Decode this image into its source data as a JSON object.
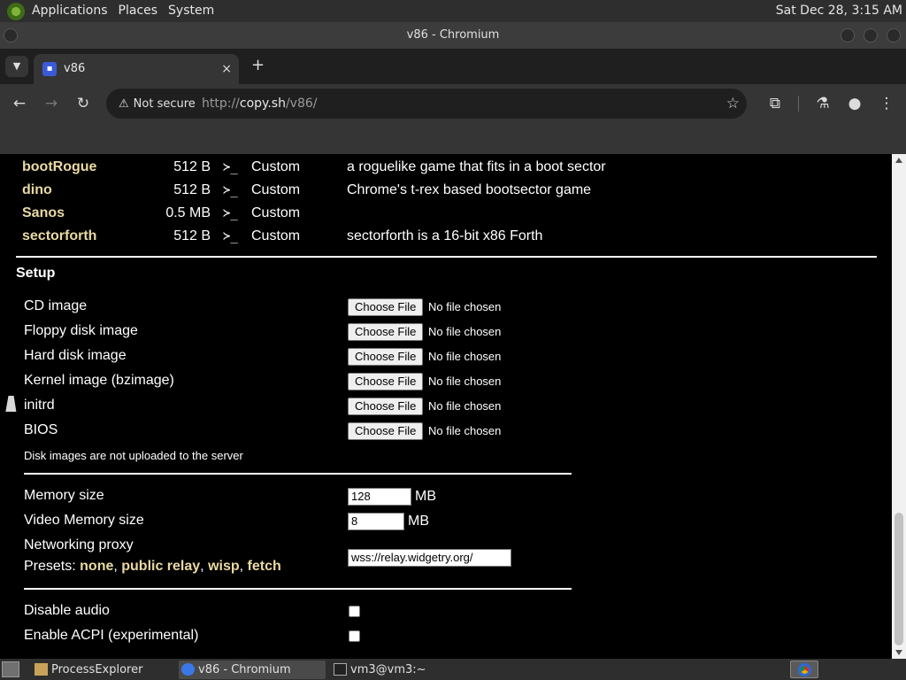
{
  "top_panel": {
    "menus": [
      "Applications",
      "Places",
      "System"
    ],
    "clock": "Sat Dec 28,  3:15 AM"
  },
  "window": {
    "title": "v86 - Chromium"
  },
  "tab": {
    "title": "v86",
    "close": "×",
    "new_tab": "+"
  },
  "toolbar": {
    "security_label": "Not secure",
    "url_scheme": "http://",
    "url_host": "copy.sh",
    "url_path": "/v86/"
  },
  "os_list": [
    {
      "name": "bootRogue",
      "size": "512 B",
      "prompt": "≻_",
      "type": "Custom",
      "description": "a roguelike game that fits in a boot sector"
    },
    {
      "name": "dino",
      "size": "512 B",
      "prompt": "≻_",
      "type": "Custom",
      "description": "Chrome's t-rex based bootsector game"
    },
    {
      "name": "Sanos",
      "size": "0.5 MB",
      "prompt": "≻_",
      "type": "Custom",
      "description": ""
    },
    {
      "name": "sectorforth",
      "size": "512 B",
      "prompt": "≻_",
      "type": "Custom",
      "description": "sectorforth is a 16-bit x86 Forth"
    }
  ],
  "setup": {
    "heading": "Setup",
    "file_inputs": [
      {
        "label": "CD image",
        "button": "Choose File",
        "status": "No file chosen"
      },
      {
        "label": "Floppy disk image",
        "button": "Choose File",
        "status": "No file chosen"
      },
      {
        "label": "Hard disk image",
        "button": "Choose File",
        "status": "No file chosen"
      },
      {
        "label": "Kernel image (bzimage)",
        "button": "Choose File",
        "status": "No file chosen"
      },
      {
        "label": "initrd",
        "button": "Choose File",
        "status": "No file chosen"
      },
      {
        "label": "BIOS",
        "button": "Choose File",
        "status": "No file chosen"
      }
    ],
    "disk_note": "Disk images are not uploaded to the server",
    "memory_label": "Memory size",
    "memory_value": "128",
    "memory_unit": "MB",
    "video_memory_label": "Video Memory size",
    "video_memory_value": "8",
    "video_memory_unit": "MB",
    "proxy_label": "Networking proxy",
    "presets_label": "Presets:",
    "presets": [
      "none",
      "public relay",
      "wisp",
      "fetch"
    ],
    "proxy_value": "wss://relay.widgetry.org/",
    "disable_audio_label": "Disable audio",
    "enable_acpi_label": "Enable ACPI (experimental)"
  },
  "taskbar": {
    "items": [
      "ProcessExplorer",
      "v86 - Chromium",
      "vm3@vm3:~"
    ]
  }
}
